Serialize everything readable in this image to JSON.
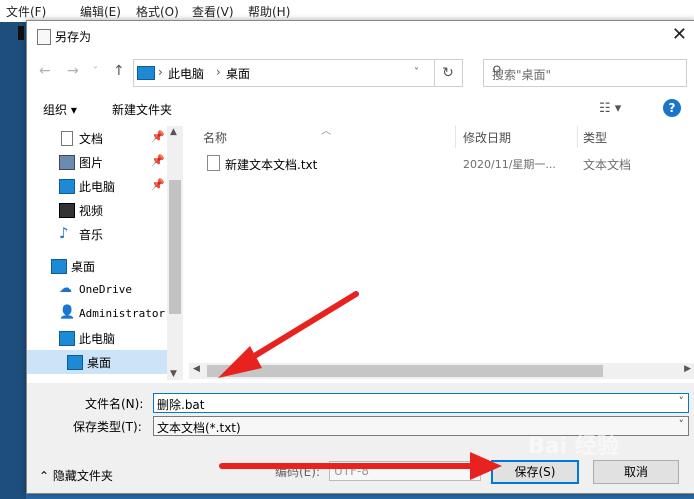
{
  "background": {
    "menu": [
      "文件(F)",
      "编辑(E)",
      "格式(O)",
      "查看(V)",
      "帮助(H)"
    ]
  },
  "dialog": {
    "title": "另存为",
    "close_glyph": "✕"
  },
  "address": {
    "crumbs": [
      "此电脑",
      "桌面"
    ],
    "separator": "›"
  },
  "search": {
    "placeholder": "搜索\"桌面\""
  },
  "toolbar": {
    "organize": "组织 ▾",
    "new_folder": "新建文件夹",
    "help": "?"
  },
  "nav": {
    "items": [
      {
        "label": "文档",
        "icon": "document-icon"
      },
      {
        "label": "图片",
        "icon": "pictures-icon"
      },
      {
        "label": "此电脑",
        "icon": "computer-icon"
      },
      {
        "label": "视频",
        "icon": "video-icon"
      },
      {
        "label": "音乐",
        "icon": "music-icon"
      },
      {
        "label": "桌面",
        "icon": "desktop-icon"
      },
      {
        "label": "OneDrive",
        "icon": "cloud-icon"
      },
      {
        "label": "Administrator",
        "icon": "user-icon"
      },
      {
        "label": "此电脑",
        "icon": "computer-icon"
      },
      {
        "label": "桌面",
        "icon": "desktop-icon",
        "selected": true
      }
    ]
  },
  "files": {
    "columns": [
      "名称",
      "修改日期",
      "类型"
    ],
    "rows": [
      {
        "name": "新建文本文档.txt",
        "date": "2020/11/星期一...",
        "type": "文本文档"
      }
    ]
  },
  "form": {
    "filename_label": "文件名(N):",
    "filename_value": "删除.bat",
    "filetype_label": "保存类型(T):",
    "filetype_value": "文本文档(*.txt)",
    "hide_folders": "隐藏文件夹",
    "encoding_label": "编码(E):",
    "encoding_value": "UTF-8",
    "save": "保存(S)",
    "cancel": "取消"
  },
  "colors": {
    "arrow": "#e8231f",
    "accent": "#0078d7"
  },
  "watermark": "Bai 经验"
}
